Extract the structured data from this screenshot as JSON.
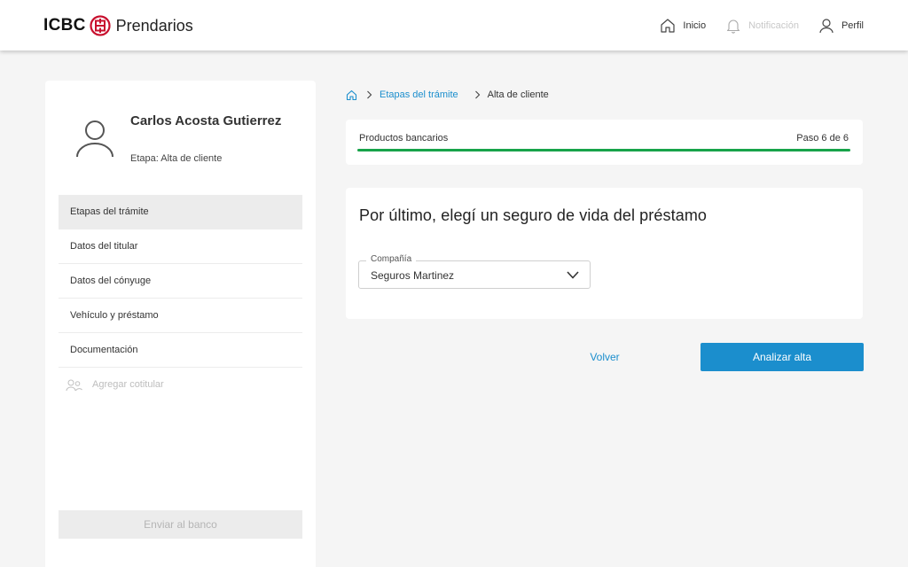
{
  "header": {
    "brand_short": "ICBC",
    "brand_name": "Prendarios",
    "nav": {
      "home_label": "Inicio",
      "notifications_label": "Notificación",
      "profile_label": "Perfil"
    }
  },
  "sidebar": {
    "user_name": "Carlos Acosta Gutierrez",
    "stage_text": "Etapa: Alta de cliente",
    "items": [
      {
        "label": "Etapas del trámite",
        "active": true
      },
      {
        "label": "Datos del titular"
      },
      {
        "label": "Datos del cónyuge"
      },
      {
        "label": "Vehículo y préstamo"
      },
      {
        "label": "Documentación"
      }
    ],
    "add_cotitular_label": "Agregar cotitular",
    "send_button_label": "Enviar al banco"
  },
  "breadcrumb": {
    "link_label": "Etapas del trámite",
    "current_label": "Alta de cliente"
  },
  "progress": {
    "title": "Productos bancarios",
    "step_text": "Paso 6 de 6",
    "fraction": 1.0
  },
  "form": {
    "title": "Por último, elegí un seguro de vida del préstamo",
    "company_label": "Compañía",
    "company_value": "Seguros Martinez"
  },
  "actions": {
    "back_label": "Volver",
    "submit_label": "Analizar alta"
  },
  "colors": {
    "accent": "#1b8ecd",
    "progress": "#17a34a",
    "brand_red": "#c8102e"
  }
}
